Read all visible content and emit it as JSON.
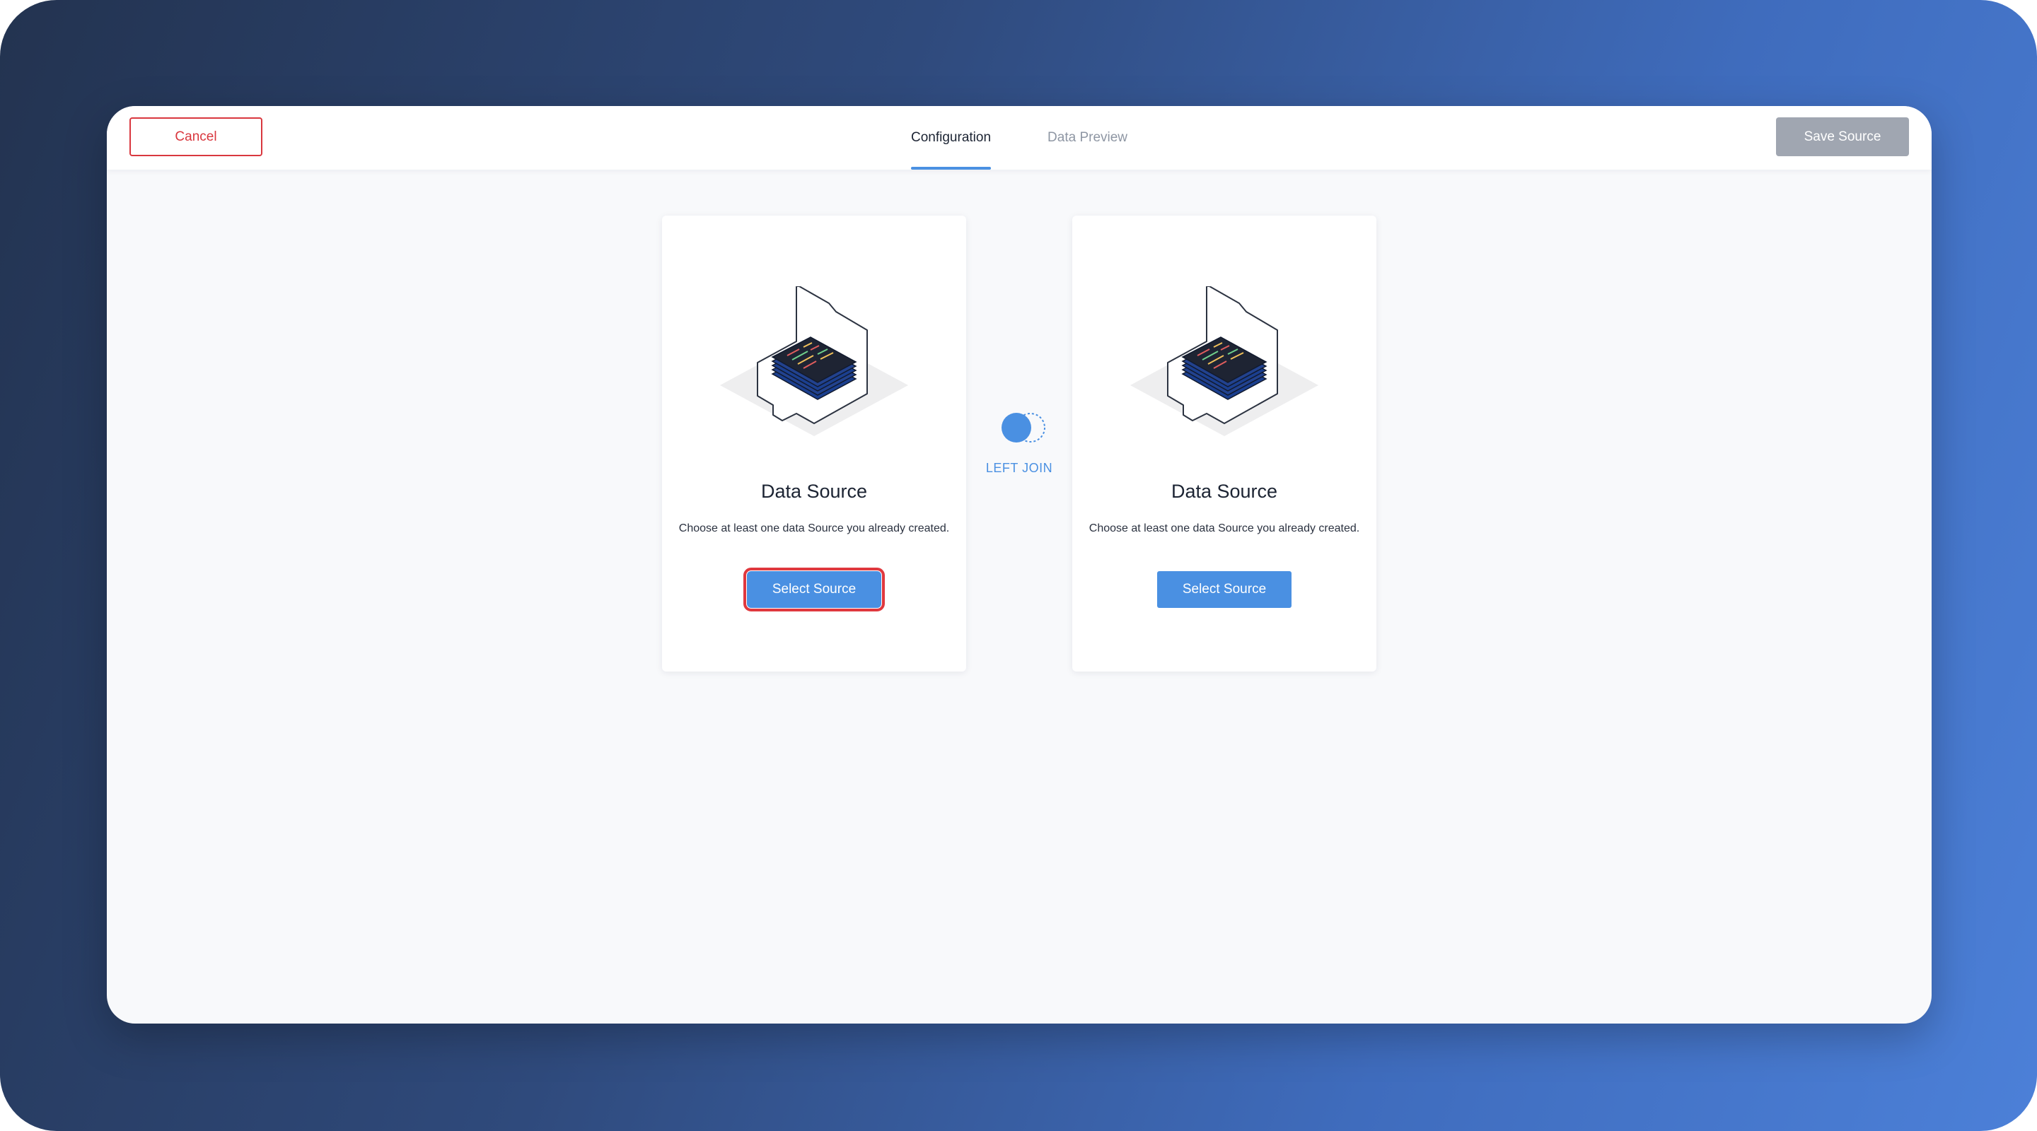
{
  "header": {
    "cancel_label": "Cancel",
    "save_label": "Save Source",
    "tabs": [
      {
        "label": "Configuration",
        "active": true
      },
      {
        "label": "Data Preview",
        "active": false
      }
    ]
  },
  "join": {
    "label": "LEFT JOIN",
    "icon": "left-join-icon"
  },
  "cards": [
    {
      "title": "Data Source",
      "description": "Choose at least one data Source you already created.",
      "button_label": "Select Source",
      "icon": "database-laptop-illustration"
    },
    {
      "title": "Data Source",
      "description": "Choose at least one data Source you already created.",
      "button_label": "Select Source",
      "icon": "database-laptop-illustration"
    }
  ],
  "colors": {
    "accent": "#4a90e2",
    "danger": "#d9373e",
    "disabled": "#a0a6b1",
    "text": "#1c2433"
  }
}
